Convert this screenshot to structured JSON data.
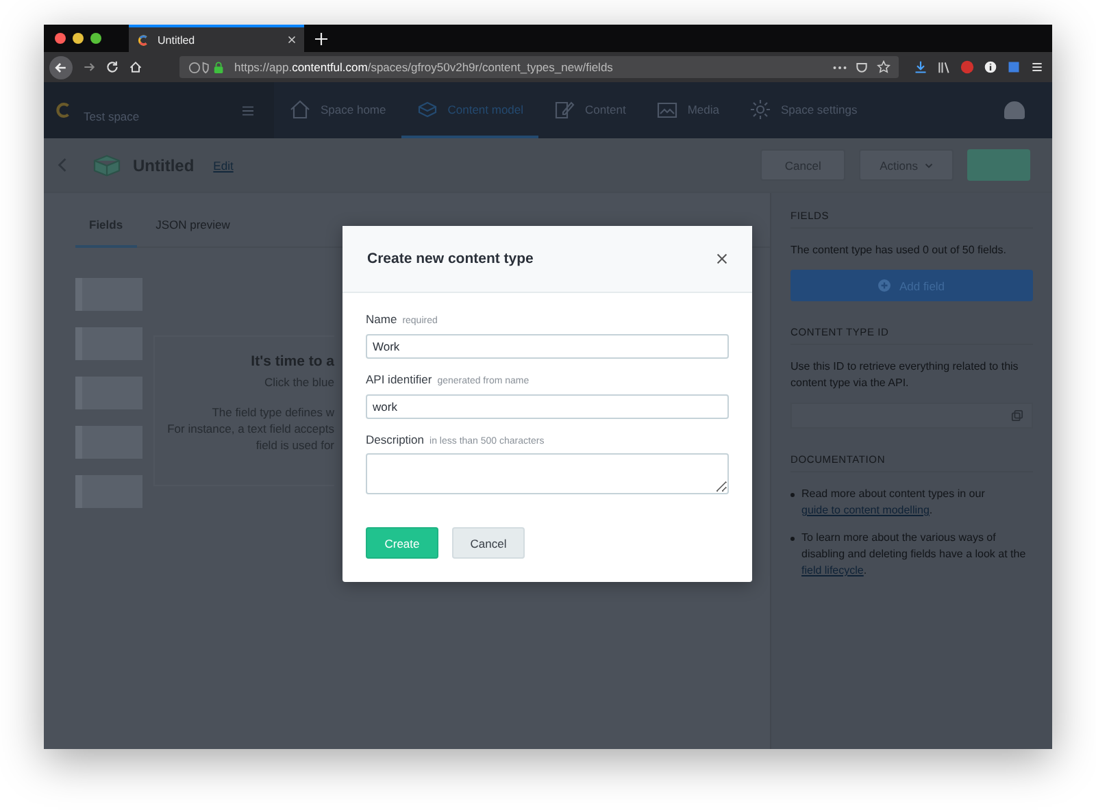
{
  "browser": {
    "tab_title": "Untitled",
    "url": "https://app.**contentful.com**/spaces/gfroy50v2h9r/content_types_new/fields"
  },
  "nav": {
    "space_name": "Test space",
    "items": [
      {
        "label": "Space home",
        "selected": false
      },
      {
        "label": "Content model",
        "selected": true
      },
      {
        "label": "Content",
        "selected": false
      },
      {
        "label": "Media",
        "selected": false
      },
      {
        "label": "Space settings",
        "selected": false
      }
    ]
  },
  "header": {
    "title": "Untitled",
    "edit_link": "Edit",
    "buttons": [
      "Cancel",
      "Actions"
    ]
  },
  "tabs": [
    {
      "label": "Fields",
      "selected": true
    },
    {
      "label": "JSON preview",
      "selected": false
    }
  ],
  "empty_state": {
    "heading": "It's time to a",
    "subheading": "Click the blue",
    "lines": [
      "The field type defines w",
      "For instance, a text field accepts",
      "field is used for"
    ]
  },
  "sidebar": {
    "sections": [
      {
        "heading": "FIELDS",
        "text": "The content type has used 0 out of 50 fields.",
        "button": "Add field"
      },
      {
        "heading": "CONTENT TYPE ID",
        "text": "Use this ID to retrieve everything related to this content type via the API."
      },
      {
        "heading": "DOCUMENTATION",
        "bullets": [
          {
            "before": "Read more about content types in our ",
            "link": "guide to content modelling",
            "after": "."
          },
          {
            "before": "To learn more about the various ways of disabling and deleting fields have a look at the ",
            "link": "field lifecycle",
            "after": "."
          }
        ]
      }
    ]
  },
  "modal": {
    "title": "Create new content type",
    "fields": [
      {
        "kind": "input",
        "label": "Name",
        "hint": "required",
        "value": "Work"
      },
      {
        "kind": "input",
        "label": "API identifier",
        "hint": "generated from name",
        "value": "work"
      },
      {
        "kind": "textarea",
        "label": "Description",
        "hint": "in less than 500 characters"
      }
    ],
    "buttons": [
      {
        "kind": "primary",
        "label": "Create"
      },
      {
        "kind": "secondary",
        "label": "Cancel"
      }
    ]
  }
}
